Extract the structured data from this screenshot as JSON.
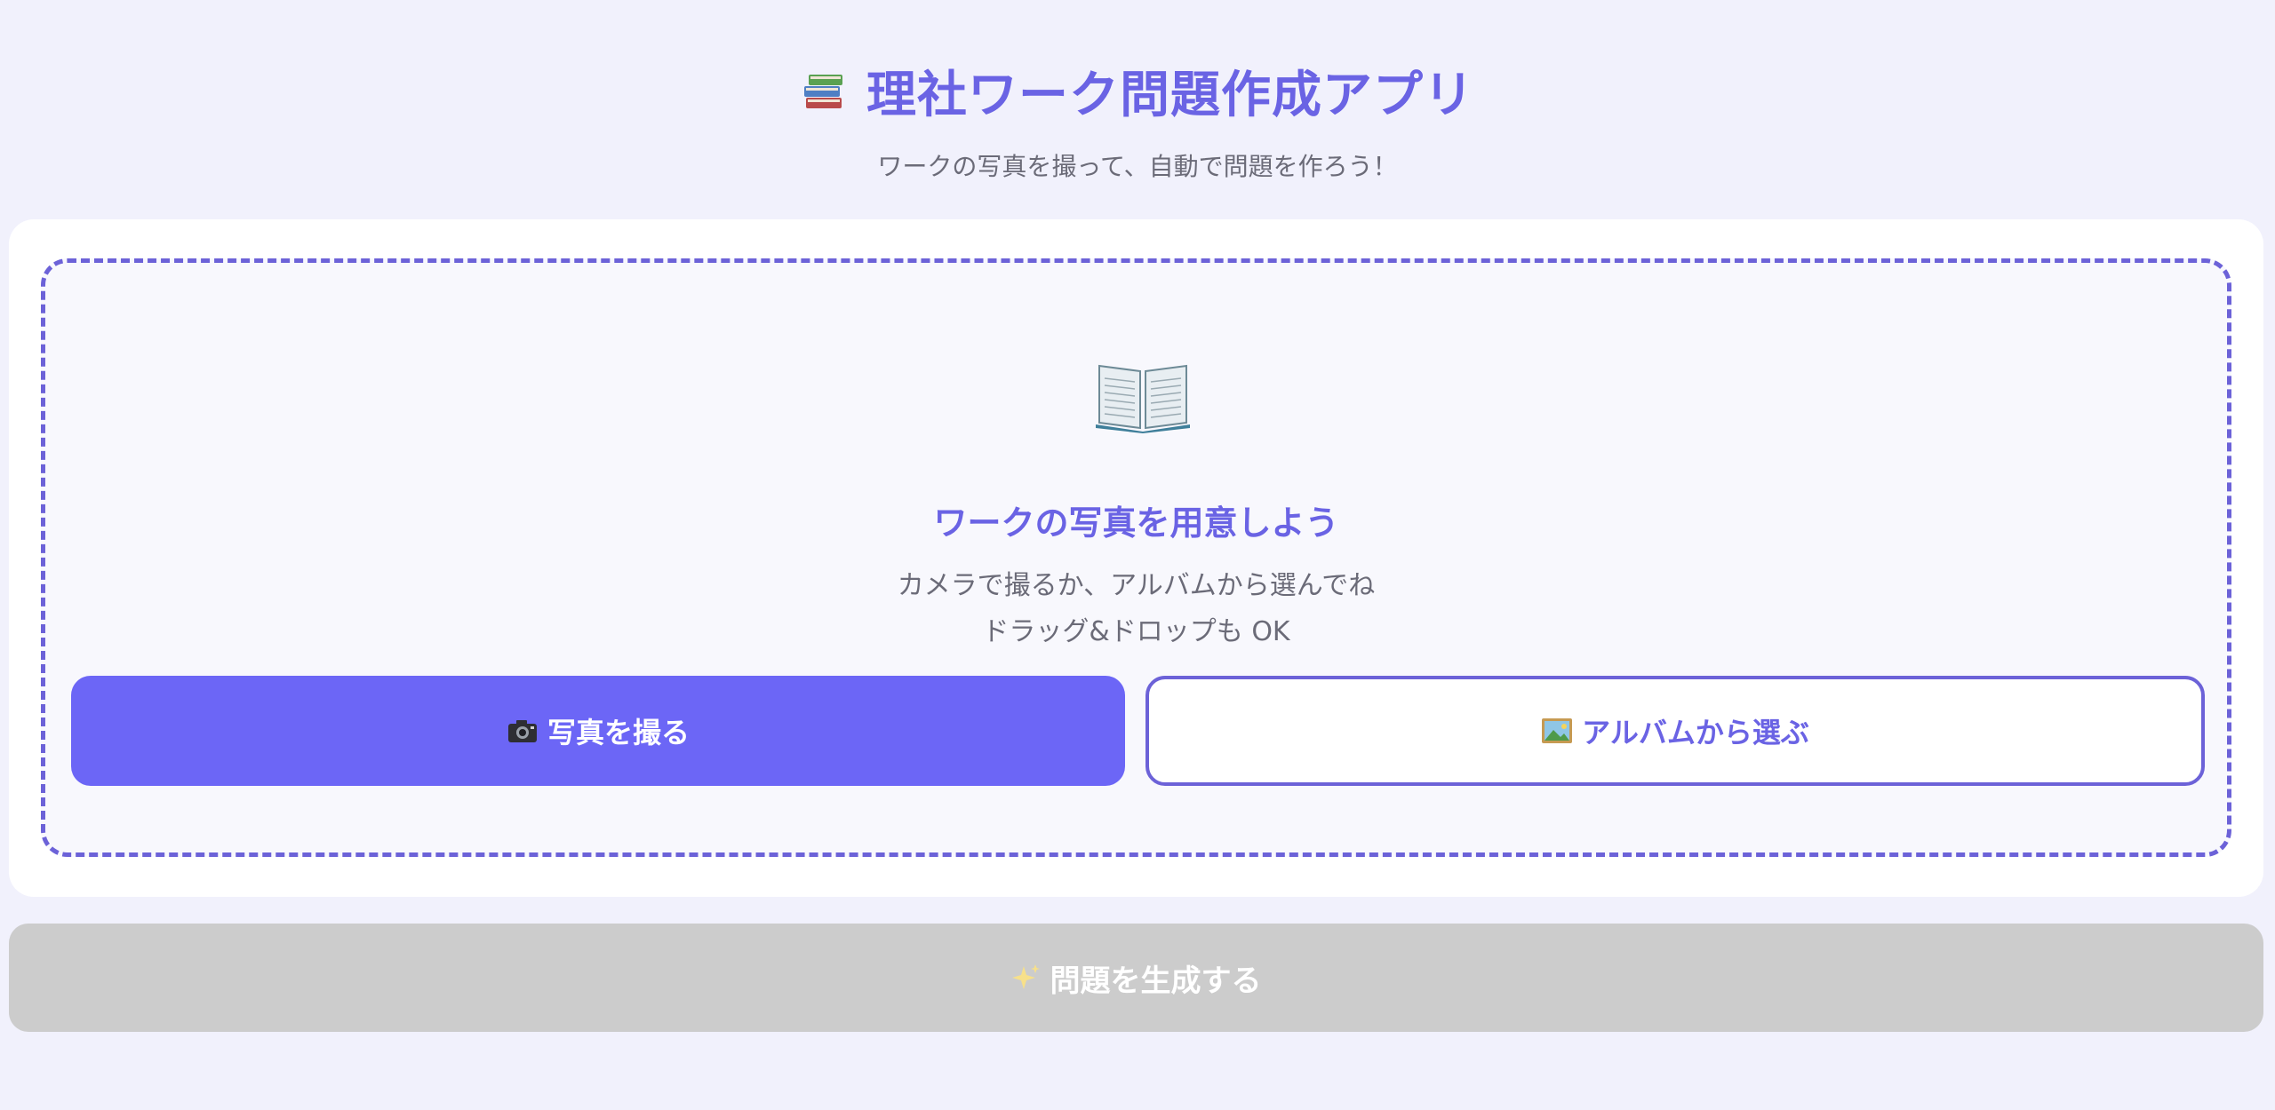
{
  "header": {
    "title": "理社ワーク問題作成アプリ",
    "title_icon": "books-icon",
    "subtitle": "ワークの写真を撮って、自動で問題を作ろう！"
  },
  "upload": {
    "icon": "open-book-icon",
    "heading": "ワークの写真を用意しよう",
    "hint_line1": "カメラで撮るか、アルバムから選んでね",
    "hint_line2": "ドラッグ&ドロップも OK",
    "camera_button": {
      "icon": "camera-icon",
      "label": "写真を撮る"
    },
    "album_button": {
      "icon": "picture-icon",
      "label": "アルバムから選ぶ"
    }
  },
  "generate_button": {
    "icon": "sparkles-icon",
    "label": "問題を生成する",
    "state": "disabled"
  },
  "colors": {
    "accent": "#6a63e4",
    "primary_button": "#6c66f6",
    "background": "#f1f1fc",
    "disabled_button": "#cccccc",
    "muted_text": "#6b6b78"
  }
}
